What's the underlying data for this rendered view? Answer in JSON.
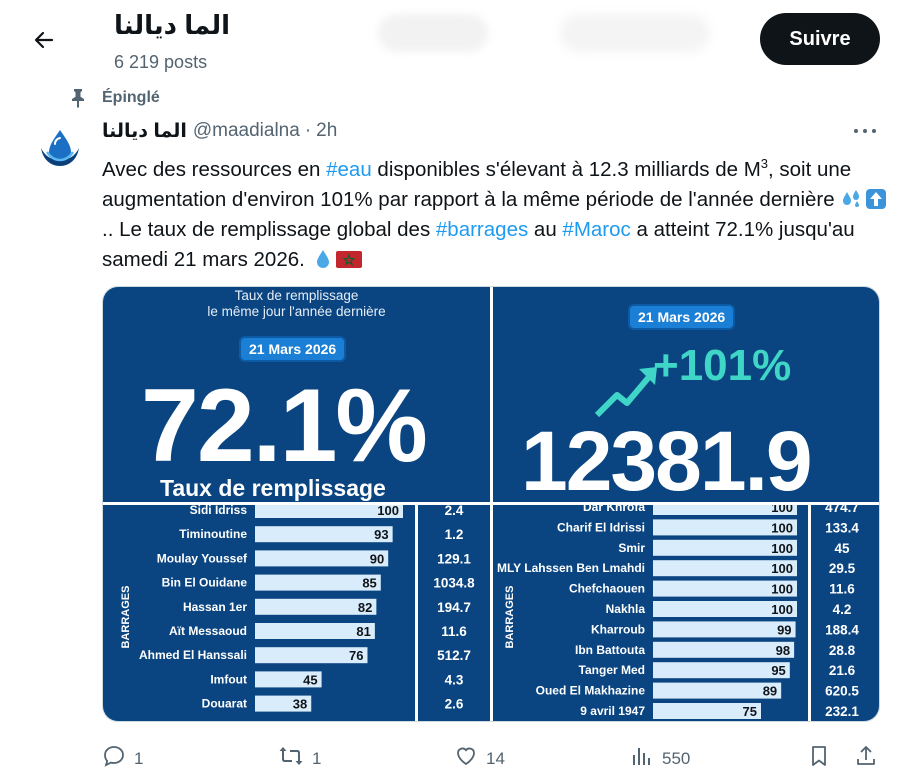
{
  "header": {
    "title": "الما ديالنا",
    "posts_count": "6 219 posts",
    "follow_label": "Suivre"
  },
  "pinned": {
    "label": "Épinglé"
  },
  "tweet": {
    "name": "الما ديالنا",
    "handle": "@maadialna",
    "dot": "·",
    "time": "2h",
    "text": {
      "p1": "Avec des ressources en ",
      "tag_eau": "#eau",
      "p2": " disponibles s'élevant à 12.3 milliards de M",
      "sup": "3",
      "p3": ", soit une augmentation d'environ 101% par rapport à la même période de l'année dernière ",
      "p4": ".. Le taux de remplissage global des ",
      "tag_barrages": "#barrages",
      "p5": " au ",
      "tag_maroc": "#Maroc",
      "p6": " a atteint 72.1% jusqu'au samedi 21 mars 2026. "
    },
    "actions": {
      "replies": "1",
      "retweets": "1",
      "likes": "14",
      "views": "550"
    }
  },
  "infographic": {
    "left_top": {
      "subtitle_1": "Taux de remplissage",
      "subtitle_2": "le même jour l'année dernière",
      "date": "21 Mars 2026",
      "value": "72.1%",
      "caption": "Taux de remplissage"
    },
    "right_top": {
      "date": "21 Mars 2026",
      "change": "+101%",
      "value": "12381.9"
    },
    "axis_label": "BARRAGES"
  },
  "chart_data": [
    {
      "type": "bar",
      "categories": [
        "Sidi Idriss",
        "Timinoutine",
        "Moulay Youssef",
        "Bin El Ouidane",
        "Hassan 1er",
        "Aït Messaoud",
        "Ahmed El Hanssali",
        "Imfout",
        "Douarat"
      ],
      "values": [
        100,
        93,
        90,
        85,
        82,
        81,
        76,
        45,
        38
      ],
      "volumes": [
        "2.4",
        "1.2",
        "129.1",
        "1034.8",
        "194.7",
        "11.6",
        "512.7",
        "4.3",
        "2.6"
      ],
      "ylabel": "BARRAGES",
      "xlim": [
        0,
        100
      ]
    },
    {
      "type": "bar",
      "categories": [
        "Dar Khrofa",
        "Charif El Idrissi",
        "Smir",
        "MLY Lahssen Ben Lmahdi",
        "Chefchaouen",
        "Nakhla",
        "Kharroub",
        "Ibn Battouta",
        "Tanger Med",
        "Oued El Makhazine",
        "9 avril 1947"
      ],
      "values": [
        100,
        100,
        100,
        100,
        100,
        100,
        99,
        98,
        95,
        89,
        75
      ],
      "volumes": [
        "474.7",
        "133.4",
        "45",
        "29.5",
        "11.6",
        "4.2",
        "188.4",
        "28.8",
        "21.6",
        "620.5",
        "232.1"
      ],
      "ylabel": "BARRAGES",
      "xlim": [
        0,
        100
      ]
    }
  ]
}
